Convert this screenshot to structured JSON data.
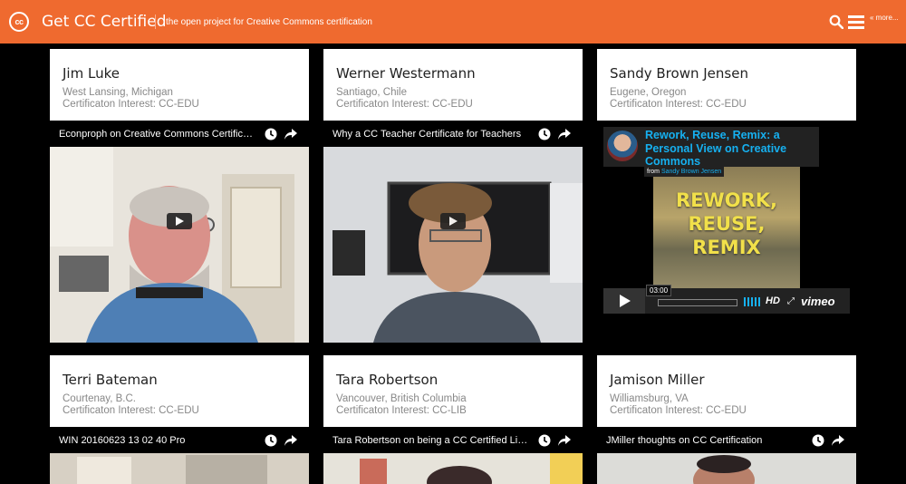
{
  "header": {
    "logo_text": "cc",
    "title": "Get CC Certified",
    "tagline": "the open project for Creative Commons certification",
    "more_label": "« more..."
  },
  "people": [
    {
      "name": "Jim Luke",
      "location": "West Lansing, Michigan",
      "interest": "Certificaton Interest: CC-EDU",
      "video_title": "Econproph on Creative Commons Certification"
    },
    {
      "name": "Werner Westermann",
      "location": "Santiago, Chile",
      "interest": "Certificaton Interest: CC-EDU",
      "video_title": "Why a CC Teacher Certificate for Teachers"
    },
    {
      "name": "Sandy Brown Jensen",
      "location": "Eugene, Oregon",
      "interest": "Certificaton Interest: CC-EDU",
      "vimeo": {
        "title": "Rework, Reuse, Remix: a Personal View on Creative Commons",
        "from_label": "from",
        "from_author": "Sandy Brown Jensen",
        "art_text": "REWORK, REUSE, REMIX",
        "time": "03:00",
        "hd_label": "HD",
        "brand": "vimeo"
      }
    },
    {
      "name": "Terri Bateman",
      "location": "Courtenay, B.C.",
      "interest": "Certificaton Interest: CC-EDU",
      "video_title": "WIN 20160623 13 02 40 Pro"
    },
    {
      "name": "Tara Robertson",
      "location": "Vancouver, British Columbia",
      "interest": "Certificaton Interest: CC-LIB",
      "video_title": "Tara Robertson on being a CC Certified Librarian"
    },
    {
      "name": "Jamison Miller",
      "location": "Williamsburg, VA",
      "interest": "Certificaton Interest: CC-EDU",
      "video_title": "JMiller thoughts on CC Certification"
    }
  ]
}
